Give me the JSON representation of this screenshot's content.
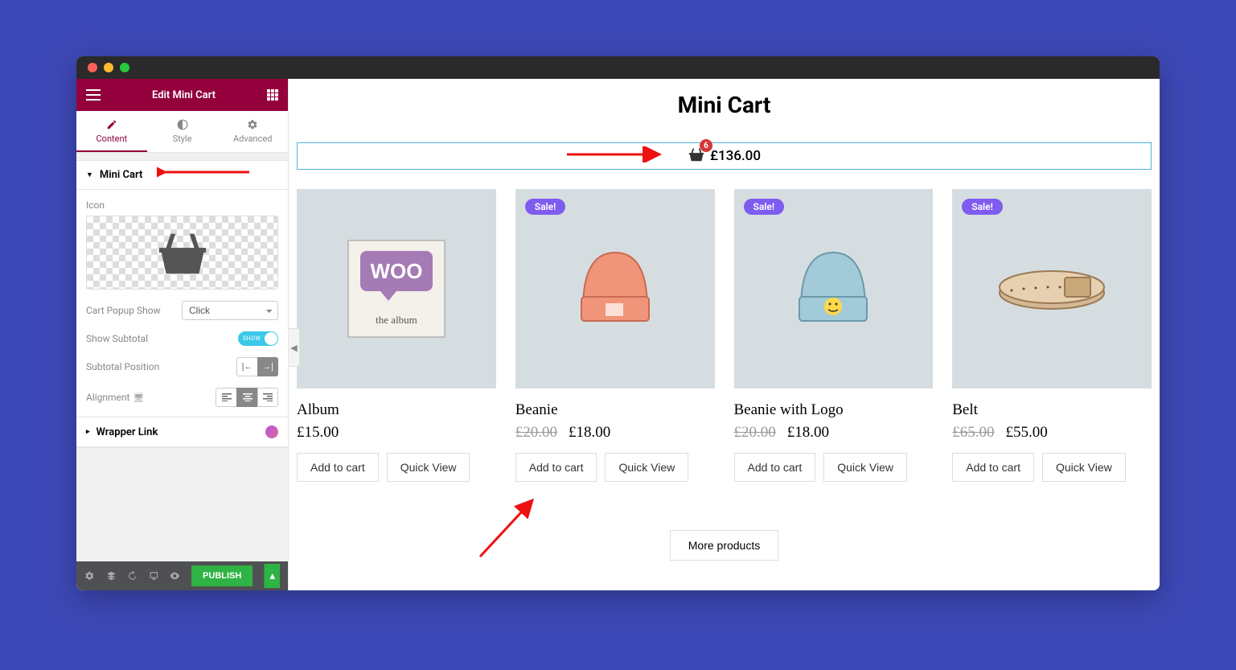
{
  "sidebar": {
    "title": "Edit Mini Cart",
    "tabs": {
      "content": "Content",
      "style": "Style",
      "advanced": "Advanced"
    },
    "section": "Mini Cart",
    "icon_label": "Icon",
    "popup_label": "Cart Popup Show",
    "popup_value": "Click",
    "subtotal_label": "Show Subtotal",
    "subtotal_toggle": "SHOW",
    "subtotal_pos_label": "Subtotal Position",
    "alignment_label": "Alignment",
    "wrapper_label": "Wrapper Link",
    "publish": "PUBLISH"
  },
  "page": {
    "title": "Mini Cart",
    "cart_count": "6",
    "cart_total": "£136.00",
    "more": "More products"
  },
  "products": [
    {
      "name": "Album",
      "sale": false,
      "old": "",
      "price": "£15.00",
      "add": "Add to cart",
      "quick": "Quick View"
    },
    {
      "name": "Beanie",
      "sale": true,
      "sale_label": "Sale!",
      "old": "£20.00",
      "price": "£18.00",
      "add": "Add to cart",
      "quick": "Quick View"
    },
    {
      "name": "Beanie with Logo",
      "sale": true,
      "sale_label": "Sale!",
      "old": "£20.00",
      "price": "£18.00",
      "add": "Add to cart",
      "quick": "Quick View"
    },
    {
      "name": "Belt",
      "sale": true,
      "sale_label": "Sale!",
      "old": "£65.00",
      "price": "£55.00",
      "add": "Add to cart",
      "quick": "Quick View"
    }
  ]
}
